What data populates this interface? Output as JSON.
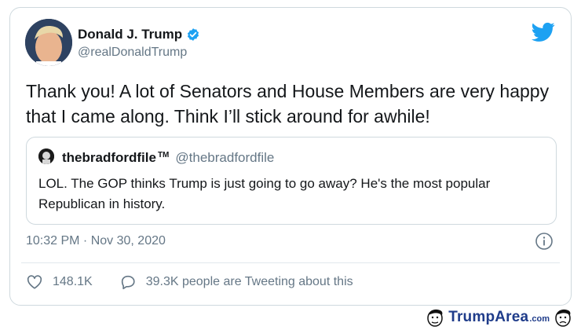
{
  "tweet": {
    "author_name": "Donald J. Trump",
    "author_handle": "@realDonaldTrump",
    "text": "Thank you! A lot of Senators and House Members are very happy that I came along. Think I’ll stick around for awhile!",
    "timestamp": "10:32 PM · Nov 30, 2020",
    "likes": "148.1K",
    "retweet_text": "39.3K people are Tweeting about this"
  },
  "quoted": {
    "author_name": "thebradfordfile",
    "tm": "TM",
    "author_handle": "@thebradfordfile",
    "text": "LOL. The GOP thinks Trump is just going to go away? He's the most popular Republican in history."
  },
  "watermark": {
    "brand": "TrumpArea",
    "suffix": ".com"
  },
  "icons": [
    "verified-badge-icon",
    "twitter-bird-icon",
    "info-icon",
    "heart-icon",
    "comment-icon"
  ],
  "colors": {
    "verified": "#1da1f2",
    "bird": "#1da1f2",
    "secondary_text": "#657786",
    "watermark": "#1f3c8a"
  }
}
